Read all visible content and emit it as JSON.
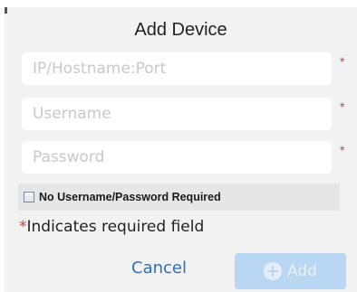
{
  "dialog": {
    "title": "Add Device"
  },
  "fields": {
    "host": {
      "placeholder": "IP/Hostname:Port",
      "value": "",
      "required_mark": "*"
    },
    "username": {
      "placeholder": "Username",
      "value": "",
      "required_mark": "*"
    },
    "password": {
      "placeholder": "Password",
      "value": "",
      "required_mark": "*"
    }
  },
  "options": {
    "no_credentials_label": "No Username/Password Required",
    "no_credentials_checked": false
  },
  "footer": {
    "required_star": "*",
    "required_note": "Indicates required field",
    "cancel_label": "Cancel",
    "add_label": "Add",
    "add_enabled": false
  },
  "colors": {
    "accent": "#2e6fb7",
    "required": "#d83a3a",
    "add_disabled_bg": "#b9d6f2"
  },
  "icons": {
    "add": "plus-circle-icon",
    "checkbox": "checkbox-icon"
  }
}
